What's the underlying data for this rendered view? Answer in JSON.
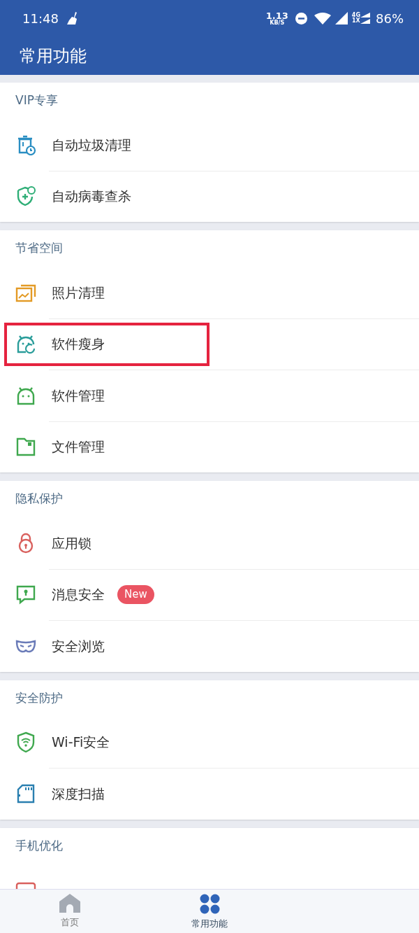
{
  "status_bar": {
    "time": "11:48",
    "speed_value": "1.13",
    "speed_unit": "KB/S",
    "network_top": "4G",
    "network_bottom": "1X",
    "battery": "86%"
  },
  "title": "常用功能",
  "sections": [
    {
      "title": "VIP专享",
      "items": [
        {
          "kind": "trash-clock",
          "label": "自动垃圾清理"
        },
        {
          "kind": "shield-plus",
          "label": "自动病毒查杀"
        }
      ]
    },
    {
      "title": "节省空间",
      "items": [
        {
          "kind": "photos",
          "label": "照片清理"
        },
        {
          "kind": "robot-refresh",
          "label": "软件瘦身",
          "highlighted": true
        },
        {
          "kind": "robot",
          "label": "软件管理"
        },
        {
          "kind": "folder",
          "label": "文件管理"
        }
      ]
    },
    {
      "title": "隐私保护",
      "items": [
        {
          "kind": "lock",
          "label": "应用锁"
        },
        {
          "kind": "message-lock",
          "label": "消息安全",
          "badge": "New"
        },
        {
          "kind": "mask",
          "label": "安全浏览"
        }
      ]
    },
    {
      "title": "安全防护",
      "items": [
        {
          "kind": "shield-wifi",
          "label": "Wi-Fi安全"
        },
        {
          "kind": "sdcard",
          "label": "深度扫描"
        }
      ]
    },
    {
      "title": "手机优化",
      "items": [
        {
          "kind": "gamepad"
        }
      ]
    }
  ],
  "bottom_nav": [
    {
      "kind": "home",
      "label": "首页",
      "selected": false
    },
    {
      "kind": "grid",
      "label": "常用功能",
      "selected": true
    }
  ]
}
